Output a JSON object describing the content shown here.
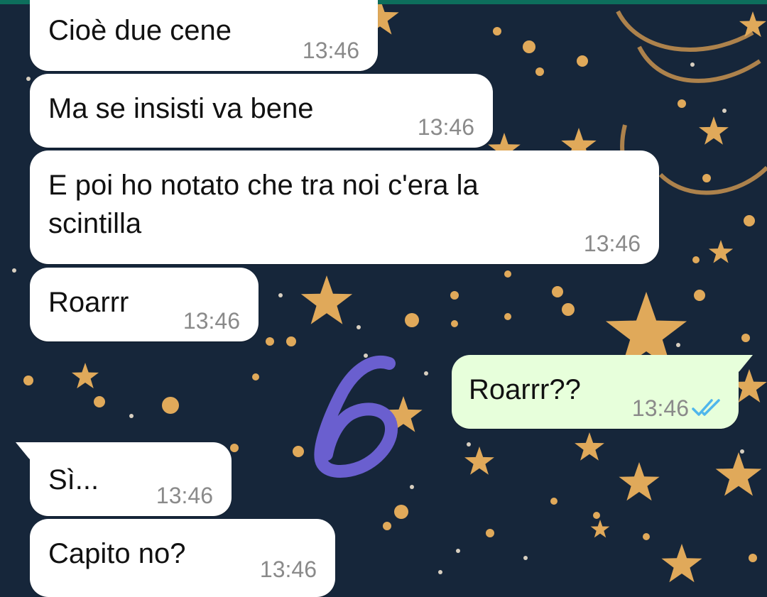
{
  "messages": [
    {
      "text": "Cioè due cene",
      "time": "13:46",
      "direction": "incoming"
    },
    {
      "text": "Ma se insisti va bene",
      "time": "13:46",
      "direction": "incoming"
    },
    {
      "text": "E poi ho notato che tra noi c'era la\nscintilla",
      "time": "13:46",
      "direction": "incoming"
    },
    {
      "text": "Roarrr",
      "time": "13:46",
      "direction": "incoming"
    },
    {
      "text": "Roarrr??",
      "time": "13:46",
      "direction": "outgoing",
      "status": "read"
    },
    {
      "text": "Sì...",
      "time": "13:46",
      "direction": "incoming"
    },
    {
      "text": "Capito no?",
      "time": "13:46",
      "direction": "incoming"
    }
  ],
  "colors": {
    "wallpaper": "#16263a",
    "star": "#e0a95a",
    "incoming_bubble": "#ffffff",
    "outgoing_bubble": "#e7ffdb",
    "read_ticks": "#4fb6ec",
    "header": "#0d6e5c",
    "doodle": "#6a5fcf"
  },
  "icons": {
    "read_receipt": "double-check-icon",
    "annotation": "handwritten-number-six"
  }
}
